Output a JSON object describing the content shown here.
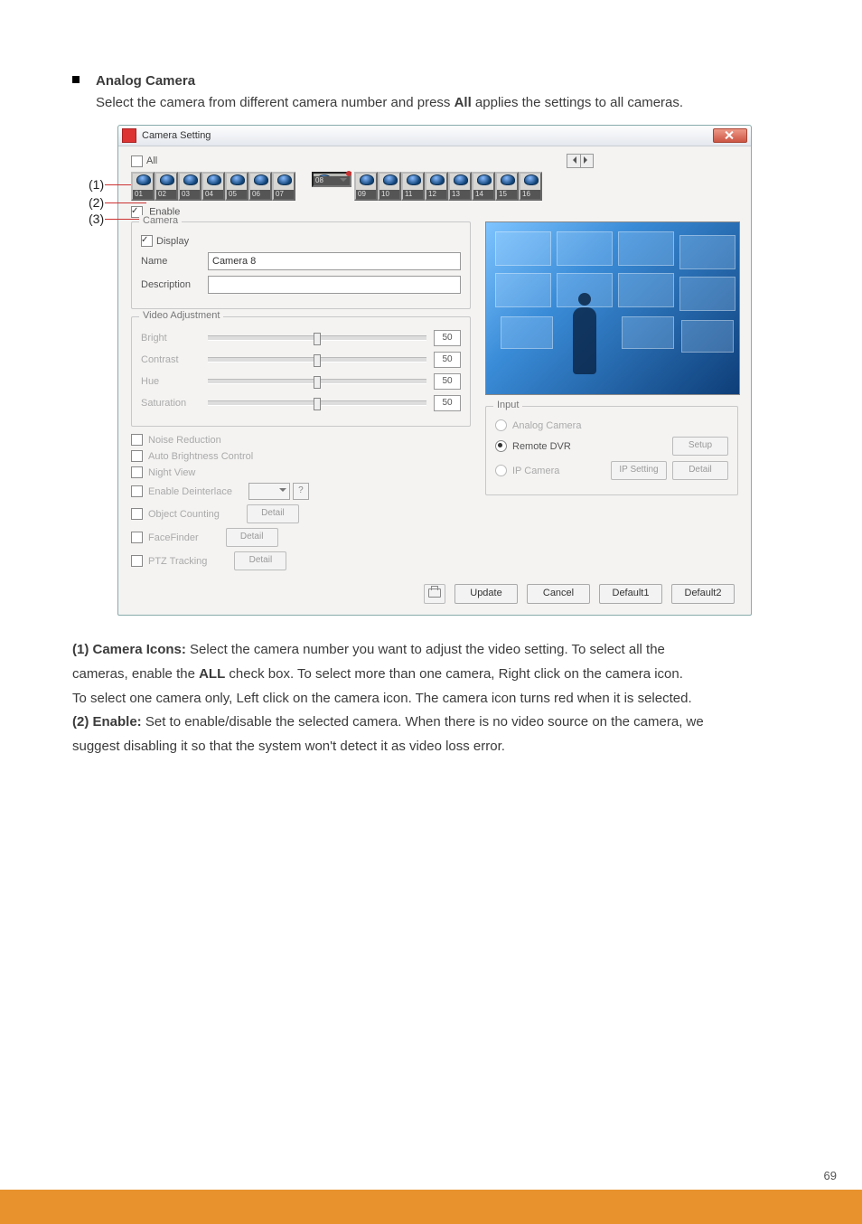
{
  "bullet_title": "Analog Camera",
  "bullet_text_1": "Select the camera from different camera number and press ",
  "bullet_text_2_bold": "All",
  "bullet_text_3": " applies the settings to all cameras.",
  "window": {
    "title": "Camera Setting",
    "all_label": "All",
    "enable_label": "Enable"
  },
  "callouts": {
    "c1": "(1)",
    "c2": "(2)",
    "c3": "(3)"
  },
  "cameras": [
    "01",
    "02",
    "03",
    "04",
    "05",
    "06",
    "07",
    "08",
    "09",
    "10",
    "11",
    "12",
    "13",
    "14",
    "15",
    "16"
  ],
  "selected_camera_index": 7,
  "camera_group": {
    "legend": "Camera",
    "display_label": "Display",
    "name_label": "Name",
    "name_value": "Camera 8",
    "desc_label": "Description",
    "desc_value": ""
  },
  "video_adj": {
    "legend": "Video Adjustment",
    "bright": {
      "label": "Bright",
      "value": "50"
    },
    "contrast": {
      "label": "Contrast",
      "value": "50"
    },
    "hue": {
      "label": "Hue",
      "value": "50"
    },
    "saturation": {
      "label": "Saturation",
      "value": "50"
    }
  },
  "options": {
    "noise": "Noise Reduction",
    "auto_bc": "Auto Brightness Control",
    "night": "Night View",
    "deint": "Enable Deinterlace",
    "objcnt": "Object Counting",
    "face": "FaceFinder",
    "ptz": "PTZ Tracking",
    "detail": "Detail",
    "q": "?"
  },
  "input": {
    "legend": "Input",
    "analog": "Analog Camera",
    "remote": "Remote DVR",
    "ip": "IP Camera",
    "setup": "Setup",
    "ipset": "IP Setting",
    "detail": "Detail"
  },
  "footer": {
    "update": "Update",
    "cancel": "Cancel",
    "d1": "Default1",
    "d2": "Default2"
  },
  "desc": {
    "l1a": "(1) Camera Icons:",
    "l1b": " Select the camera number you want to adjust the video setting. To select all the",
    "l2a": "cameras, enable the ",
    "l2b": "ALL",
    "l2c": " check box. To select more than one camera, Right click on the camera icon.",
    "l3": "To select one camera only, Left click on the camera icon. The camera icon turns red when it is selected.",
    "l4a": "(2) Enable:",
    "l4b": " Set to enable/disable the selected camera. When there is no video source on the camera, we",
    "l5": "suggest disabling it so that the system won't detect it as video loss error."
  },
  "page_number": "69"
}
